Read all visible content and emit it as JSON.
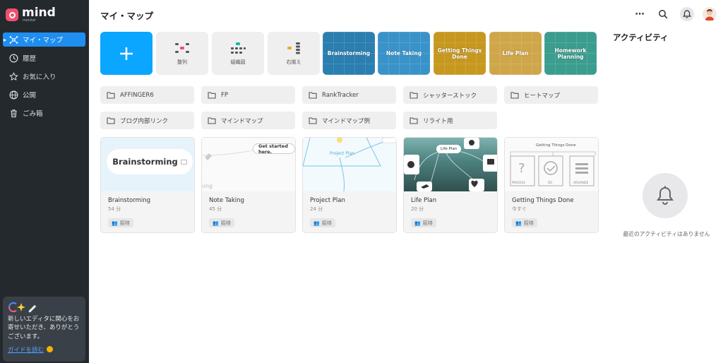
{
  "app": {
    "name": "mind",
    "sub": "meister"
  },
  "sidebar": {
    "items": [
      {
        "label": "マイ・マップ",
        "icon": "mindmap-icon"
      },
      {
        "label": "履歴",
        "icon": "clock-icon"
      },
      {
        "label": "お気に入り",
        "icon": "star-icon"
      },
      {
        "label": "公開",
        "icon": "globe-icon"
      },
      {
        "label": "ごみ箱",
        "icon": "trash-icon"
      }
    ],
    "promo": {
      "text": "新しいエディタに関心をお寄せいただき、ありがとうございます。",
      "link": "ガイドを読む"
    }
  },
  "header": {
    "title": "マイ・マップ",
    "more": "⋯"
  },
  "templates": [
    {
      "label": "整列"
    },
    {
      "label": "組織図"
    },
    {
      "label": "右揃え"
    },
    {
      "label": "Brainstorming",
      "color": "#2b7eb0"
    },
    {
      "label": "Note Taking",
      "color": "#3a93c8"
    },
    {
      "label": "Getting Things Done",
      "color": "#c7981f"
    },
    {
      "label": "Life Plan",
      "color": "#cfa64a"
    },
    {
      "label": "Homework Planning",
      "color": "#3b9d8e"
    }
  ],
  "folders": [
    "AFFINGER6",
    "FP",
    "RankTracker",
    "シャッターストック",
    "ヒートマップ",
    "ブログ内部リンク",
    "マインドマップ",
    "マインドマップ例",
    "リライト用"
  ],
  "maps": [
    {
      "title": "Brainstorming",
      "time": "54 分",
      "badge": "招待",
      "thumb_text": "Brainstorming"
    },
    {
      "title": "Note Taking",
      "time": "45 分",
      "badge": "招待",
      "thumb_text": "Get started here.",
      "thumb_sub": "king"
    },
    {
      "title": "Project Plan",
      "time": "24 分",
      "badge": "招待",
      "thumb_text": "Project Plan"
    },
    {
      "title": "Life Plan",
      "time": "20 分",
      "badge": "招待",
      "thumb_text": "Life Plan"
    },
    {
      "title": "Getting Things Done",
      "time": "今すぐ",
      "badge": "招待",
      "thumb_text": "Getting Things Done",
      "thumb_labels": [
        "PROCESS",
        "DO",
        "ORGANIZE"
      ]
    }
  ],
  "activity": {
    "title": "アクティビティ",
    "empty": "最近のアクティビティはありません"
  },
  "colors": {
    "accent": "#0aa6ff",
    "sidebar": "#24292e",
    "active": "#1f8ef1"
  }
}
